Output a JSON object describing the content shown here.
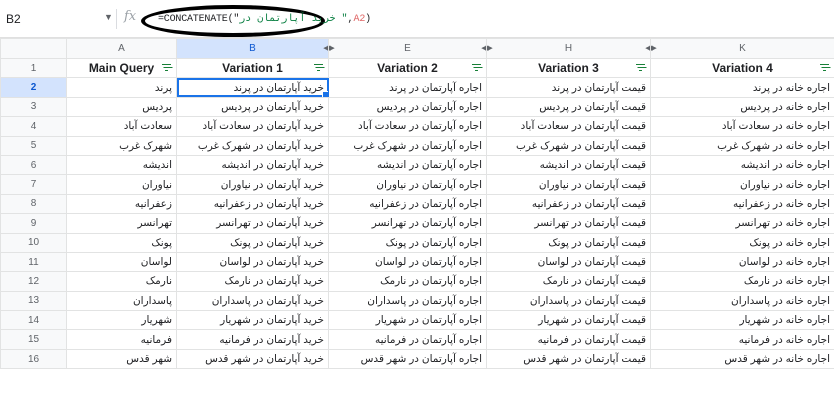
{
  "formula_bar": {
    "name_box": "B2",
    "fx": "fx",
    "formula_prefix": "=CONCATENATE(\"",
    "formula_string": "خرید آپارتمان در \"",
    "formula_sep": ",",
    "formula_ref": "A2",
    "formula_suffix": ")"
  },
  "columns": [
    "A",
    "B",
    "E",
    "H",
    "K"
  ],
  "header": [
    "Main Query",
    "Variation 1",
    "Variation 2",
    "Variation 3",
    "Variation 4"
  ],
  "rows": [
    {
      "n": "2",
      "cells": [
        "پرند",
        "خرید آپارتمان در پرند",
        "اجاره آپارتمان در پرند",
        "قیمت آپارتمان در پرند",
        "اجاره خانه در پرند"
      ]
    },
    {
      "n": "3",
      "cells": [
        "پردیس",
        "خرید آپارتمان در پردیس",
        "اجاره آپارتمان در پردیس",
        "قیمت آپارتمان در پردیس",
        "اجاره خانه در پردیس"
      ]
    },
    {
      "n": "4",
      "cells": [
        "سعادت آباد",
        "خرید آپارتمان در سعادت آباد",
        "اجاره آپارتمان در سعادت آباد",
        "قیمت آپارتمان در سعادت آباد",
        "اجاره خانه در سعادت آباد"
      ]
    },
    {
      "n": "5",
      "cells": [
        "شهرک غرب",
        "خرید آپارتمان در شهرک غرب",
        "اجاره آپارتمان در شهرک غرب",
        "قیمت آپارتمان در شهرک غرب",
        "اجاره خانه در شهرک غرب"
      ]
    },
    {
      "n": "6",
      "cells": [
        "اندیشه",
        "خرید آپارتمان در اندیشه",
        "اجاره آپارتمان در اندیشه",
        "قیمت آپارتمان در اندیشه",
        "اجاره خانه در اندیشه"
      ]
    },
    {
      "n": "7",
      "cells": [
        "نیاوران",
        "خرید آپارتمان در نیاوران",
        "اجاره آپارتمان در نیاوران",
        "قیمت آپارتمان در نیاوران",
        "اجاره خانه در نیاوران"
      ]
    },
    {
      "n": "8",
      "cells": [
        "زعفرانیه",
        "خرید آپارتمان در زعفرانیه",
        "اجاره آپارتمان در زعفرانیه",
        "قیمت آپارتمان در زعفرانیه",
        "اجاره خانه در زعفرانیه"
      ]
    },
    {
      "n": "9",
      "cells": [
        "تهرانسر",
        "خرید آپارتمان در تهرانسر",
        "اجاره آپارتمان در تهرانسر",
        "قیمت آپارتمان در تهرانسر",
        "اجاره خانه در تهرانسر"
      ]
    },
    {
      "n": "10",
      "cells": [
        "پونک",
        "خرید آپارتمان در پونک",
        "اجاره آپارتمان در پونک",
        "قیمت آپارتمان در پونک",
        "اجاره خانه در پونک"
      ]
    },
    {
      "n": "11",
      "cells": [
        "لواسان",
        "خرید آپارتمان در لواسان",
        "اجاره آپارتمان در لواسان",
        "قیمت آپارتمان در لواسان",
        "اجاره خانه در لواسان"
      ]
    },
    {
      "n": "12",
      "cells": [
        "نارمک",
        "خرید آپارتمان در نارمک",
        "اجاره آپارتمان در نارمک",
        "قیمت آپارتمان در نارمک",
        "اجاره خانه در نارمک"
      ]
    },
    {
      "n": "13",
      "cells": [
        "پاسداران",
        "خرید آپارتمان در پاسداران",
        "اجاره آپارتمان در پاسداران",
        "قیمت آپارتمان در پاسداران",
        "اجاره خانه در پاسداران"
      ]
    },
    {
      "n": "14",
      "cells": [
        "شهریار",
        "خرید آپارتمان در شهریار",
        "اجاره آپارتمان در شهریار",
        "قیمت آپارتمان در شهریار",
        "اجاره خانه در شهریار"
      ]
    },
    {
      "n": "15",
      "cells": [
        "فرمانیه",
        "خرید آپارتمان در فرمانیه",
        "اجاره آپارتمان در فرمانیه",
        "قیمت آپارتمان در فرمانیه",
        "اجاره خانه در فرمانیه"
      ]
    },
    {
      "n": "16",
      "cells": [
        "شهر قدس",
        "خرید آپارتمان در شهر قدس",
        "اجاره آپارتمان در شهر قدس",
        "قیمت آپارتمان در شهر قدس",
        "اجاره خانه در شهر قدس"
      ]
    }
  ],
  "header_row_number": "1",
  "selection": {
    "row": "2",
    "column": "B"
  },
  "colors": {
    "accent": "#1a73e8",
    "filter": "#188038"
  }
}
